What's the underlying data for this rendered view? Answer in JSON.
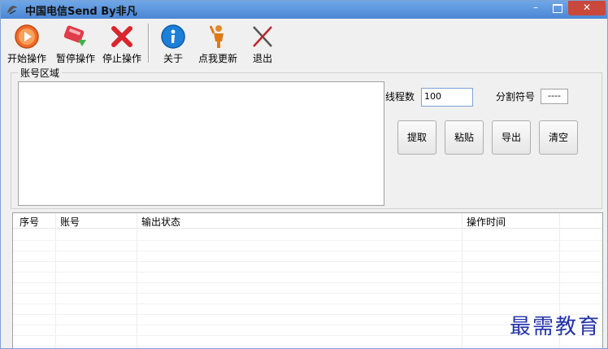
{
  "window": {
    "title": "中国电信Send By非凡",
    "controls": {
      "minimize": "–",
      "close": "✕"
    }
  },
  "toolbar": {
    "start": "开始操作",
    "pause": "暂停操作",
    "stop": "停止操作",
    "about": "关于",
    "update": "点我更新",
    "exit": "退出"
  },
  "account_area": {
    "group_title": "账号区域",
    "threads_label": "线程数",
    "threads_value": "100",
    "delimiter_label": "分割符号",
    "delimiter_value": "----",
    "buttons": {
      "extract": "提取",
      "paste": "粘贴",
      "export": "导出",
      "clear": "清空"
    }
  },
  "list": {
    "columns": [
      "序号",
      "账号",
      "输出状态",
      "操作时间"
    ]
  },
  "watermark": "最需教育",
  "colors": {
    "accent": "#4a86d6",
    "close": "#c9483b",
    "watermark": "#2233aa"
  }
}
